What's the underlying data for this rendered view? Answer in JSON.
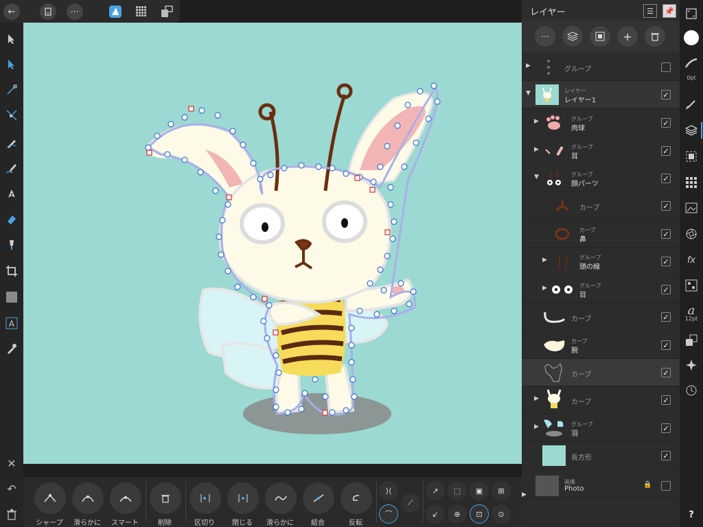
{
  "topbar": {
    "icons": [
      "back-arrow-icon",
      "document-icon",
      "more-icon",
      "designer-persona-icon",
      "pixel-persona-icon",
      "export-persona-icon"
    ]
  },
  "panel": {
    "title": "レイヤー",
    "layers": [
      {
        "type": "",
        "name": "グループ",
        "visible": false,
        "expand": "▶"
      },
      {
        "type": "レイヤー",
        "name": "レイヤー1",
        "visible": true,
        "expand": "▼"
      },
      {
        "type": "グループ",
        "name": "肉球",
        "visible": true,
        "expand": "▶"
      },
      {
        "type": "グループ",
        "name": "耳",
        "visible": true,
        "expand": "▶"
      },
      {
        "type": "グループ",
        "name": "顔パーツ",
        "visible": true,
        "expand": "▼"
      },
      {
        "type": "",
        "name": "カーブ",
        "visible": true,
        "expand": ""
      },
      {
        "type": "カーブ",
        "name": "鼻",
        "visible": true,
        "expand": ""
      },
      {
        "type": "グループ",
        "name": "頭の線",
        "visible": true,
        "expand": "▶"
      },
      {
        "type": "グループ",
        "name": "目",
        "visible": true,
        "expand": "▶"
      },
      {
        "type": "",
        "name": "カーブ",
        "visible": true,
        "expand": ""
      },
      {
        "type": "カーブ",
        "name": "腕",
        "visible": true,
        "expand": ""
      },
      {
        "type": "",
        "name": "カーブ",
        "visible": true,
        "expand": ""
      },
      {
        "type": "",
        "name": "カーブ",
        "visible": true,
        "expand": "▶"
      },
      {
        "type": "グループ",
        "name": "羽",
        "visible": true,
        "expand": "▶"
      },
      {
        "type": "",
        "name": "長方形",
        "visible": true,
        "expand": ""
      },
      {
        "type": "画像",
        "name": "Photo",
        "visible": false,
        "expand": "▶",
        "locked": true
      }
    ]
  },
  "bottombar": {
    "labels": [
      "シャープ",
      "滑らかに",
      "スマート",
      "削除",
      "区切り",
      "閉じる",
      "滑らかに",
      "結合",
      "反転"
    ]
  },
  "studio": {
    "stroke_width": "0pt",
    "font_size": "12pt",
    "help": "?"
  },
  "colors": {
    "canvas_bg": "#9bd9d2",
    "accent": "#4aa3e0",
    "panel_bg": "#2c2c2c"
  }
}
